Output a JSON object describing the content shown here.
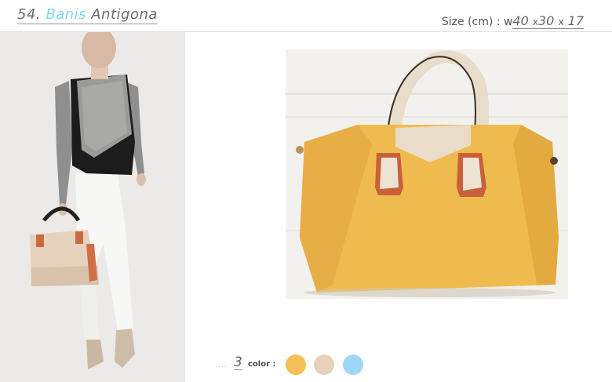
{
  "header": {
    "number": "54.",
    "brand": "Banis",
    "name": "Antigona",
    "size_label": "Size (cm) : w",
    "dims": [
      "40",
      "30",
      "17"
    ],
    "dim_sep": "x"
  },
  "photos": {
    "model_icon": "model-photo",
    "product_icon": "yellow-tote-bag-photo"
  },
  "colors": {
    "count": "3",
    "label": "color :",
    "swatches": [
      {
        "name": "yellow",
        "hex": "#f5bf57"
      },
      {
        "name": "beige",
        "hex": "#e6d1bb"
      },
      {
        "name": "sky-blue",
        "hex": "#9ed8f7"
      }
    ]
  }
}
